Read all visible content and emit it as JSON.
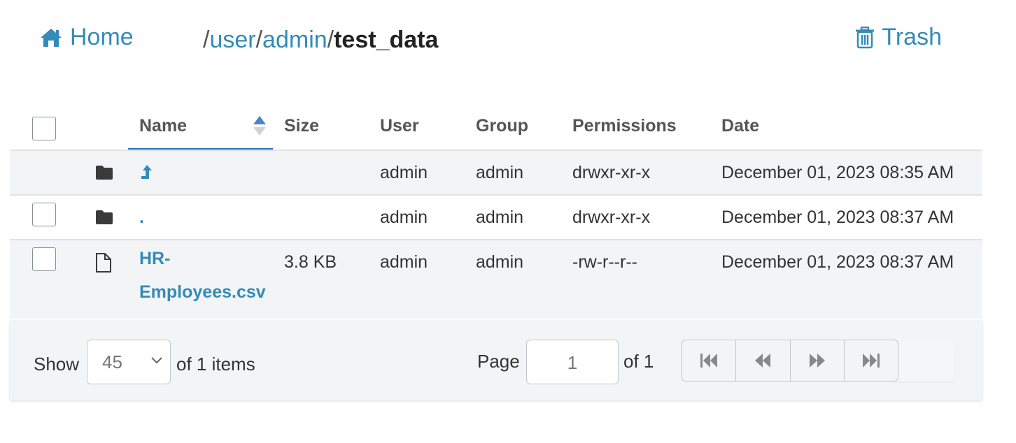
{
  "header": {
    "home_label": "Home",
    "breadcrumb": {
      "sep1": "/",
      "seg1": "user",
      "sep2": "/",
      "seg2": "admin",
      "sep3": "/",
      "current": "test_data"
    },
    "trash_label": "Trash"
  },
  "table": {
    "columns": {
      "name": "Name",
      "size": "Size",
      "user": "User",
      "group": "Group",
      "permissions": "Permissions",
      "date": "Date"
    },
    "rows": [
      {
        "type": "folder",
        "name": "",
        "size": "",
        "user": "admin",
        "group": "admin",
        "permissions": "drwxr-xr-x",
        "date": "December 01, 2023 08:35 AM"
      },
      {
        "type": "folder",
        "name": ".",
        "size": "",
        "user": "admin",
        "group": "admin",
        "permissions": "drwxr-xr-x",
        "date": "December 01, 2023 08:37 AM"
      },
      {
        "type": "file",
        "name_line1": "HR-",
        "name_line2": "Employees.csv",
        "size": "3.8 KB",
        "user": "admin",
        "group": "admin",
        "permissions": "-rw-r--r--",
        "date": "December 01, 2023 08:37 AM"
      }
    ]
  },
  "footer": {
    "show_label": "Show",
    "page_size": "45",
    "items_label": "of 1 items",
    "page_label": "Page",
    "page_value": "1",
    "page_total_label": "of 1"
  },
  "colors": {
    "link": "#338bb8",
    "sort_active": "#2f6dc1",
    "row_alt": "#f3f4f6"
  },
  "icons": [
    "home-icon",
    "trash-icon",
    "sort-icon",
    "folder-icon",
    "parent-dir-icon",
    "file-icon",
    "first-page-icon",
    "prev-page-icon",
    "next-page-icon",
    "last-page-icon"
  ]
}
